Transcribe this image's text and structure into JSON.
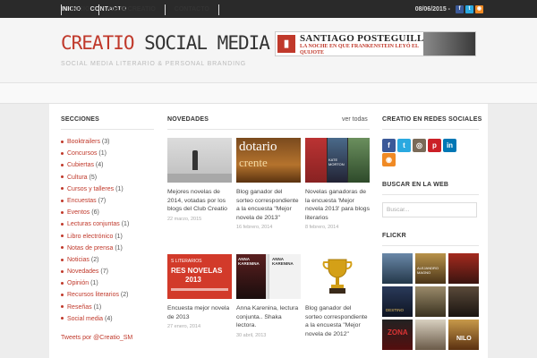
{
  "topbar": {
    "nav": [
      "INICIO",
      "CONTACTO"
    ],
    "date": "08/06/2015 -",
    "social_icons": [
      "facebook-icon",
      "twitter-icon",
      "rss-icon"
    ],
    "colors": {
      "facebook": "#3b5998",
      "twitter": "#2aa9e0",
      "rss": "#f08a24"
    }
  },
  "header": {
    "logo_part1": "CREATIO",
    "logo_part2": "SOCIAL MEDIA",
    "tagline": "SOCIAL MEDIA LITERARIO & PERSONAL BRANDING",
    "banner": {
      "author": "SANTIAGO POSTEGUILLO",
      "book": "LA NOCHE EN QUE FRANKENSTEIN LEYÓ EL QUIJOTE"
    }
  },
  "nav": [
    "INICIO",
    "CLUB CREATIO",
    "CONTACTO"
  ],
  "sidebar_left": {
    "title": "SECCIONES",
    "categories": [
      {
        "name": "Booktrailers",
        "count": "(3)"
      },
      {
        "name": "Concursos",
        "count": "(1)"
      },
      {
        "name": "Cubiertas",
        "count": "(4)"
      },
      {
        "name": "Cultura",
        "count": "(5)"
      },
      {
        "name": "Cursos y talleres",
        "count": "(1)"
      },
      {
        "name": "Encuestas",
        "count": "(7)"
      },
      {
        "name": "Eventos",
        "count": "(6)"
      },
      {
        "name": "Lecturas conjuntas",
        "count": "(1)"
      },
      {
        "name": "Libro electrónico",
        "count": "(1)"
      },
      {
        "name": "Notas de prensa",
        "count": "(1)"
      },
      {
        "name": "Noticias",
        "count": "(2)"
      },
      {
        "name": "Novedades",
        "count": "(7)"
      },
      {
        "name": "Opinión",
        "count": "(1)"
      },
      {
        "name": "Recursos literarios",
        "count": "(2)"
      },
      {
        "name": "Reseñas",
        "count": "(1)"
      },
      {
        "name": "Social media",
        "count": "(4)"
      }
    ],
    "tweets_link": "Tweets por @Creatio_SM"
  },
  "main": {
    "title": "NOVEDADES",
    "see_all": "ver todas",
    "posts": [
      {
        "title": "Mejores novelas de 2014, votadas por los blogs del Club Creatio",
        "date": "22 marzo, 2015"
      },
      {
        "title": "Blog ganador del sorteo correspondiente a la encuesta \"Mejor novela de 2013\"",
        "date": "16 febrero, 2014"
      },
      {
        "title": "Novelas ganadoras de la encuesta 'Mejor novela 2013' para blogs literarios",
        "date": "8 febrero, 2014"
      },
      {
        "title": "Encuesta mejor novela de 2013",
        "date": "27 enero, 2014"
      },
      {
        "title": "Anna Karenina, lectura conjunta.. Shaka lectora.",
        "date": "30 abril, 2013"
      },
      {
        "title": "Blog ganador del sorteo correspondiente a la encuesta \"Mejor novela de 2012\"",
        "date": ""
      }
    ],
    "thumb_texts": {
      "dotario": "dotario",
      "crente": "crente",
      "kate": "KATE MORTON",
      "literarios": "S LITERARIOS",
      "novelas": "RES NOVELAS",
      "year": "2013",
      "karenina": "ANNA KARENINA",
      "karenina2": "ANNA KARENINA"
    }
  },
  "sidebar_right": {
    "social_title": "CREATIO EN REDES SOCIALES",
    "social_icons": [
      "facebook-icon",
      "twitter-icon",
      "instagram-icon",
      "pinterest-icon",
      "linkedin-icon",
      "rss-icon"
    ],
    "social_colors": [
      "#3b5998",
      "#2aa9e0",
      "#7a6a58",
      "#cb2027",
      "#0077b5",
      "#f08a24"
    ],
    "search_title": "BUSCAR EN LA WEB",
    "search_placeholder": "Buscar...",
    "flickr_title": "FLICKR",
    "flickr_texts": [
      "",
      "ALEJANDRO MAGNO",
      "",
      "DESTINO",
      "",
      "",
      "ZONA",
      "",
      "NILO"
    ]
  },
  "accent_color": "#c0392b"
}
